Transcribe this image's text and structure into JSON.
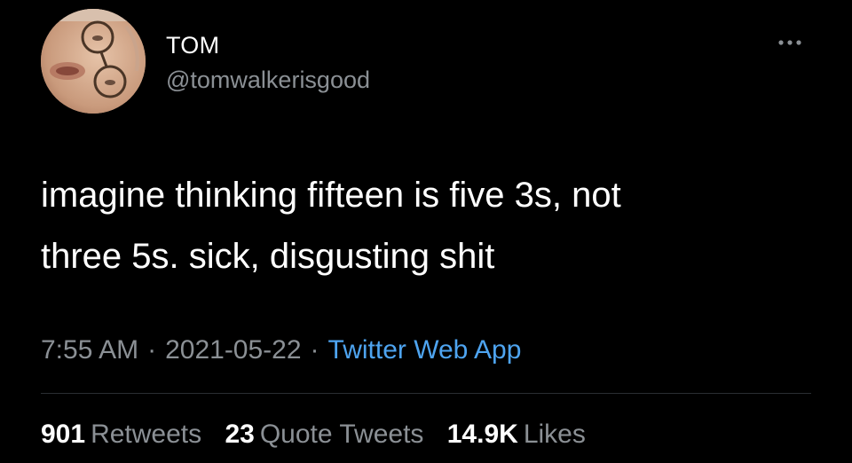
{
  "author": {
    "display_name": "TOM",
    "handle": "@tomwalkerisgood"
  },
  "tweet": {
    "text_lines": [
      "imagine thinking fifteen is five 3s, not",
      "three 5s. sick, disgusting shit"
    ]
  },
  "meta": {
    "time": "7:55 AM",
    "separator": "·",
    "date": "2021-05-22",
    "source": "Twitter Web App"
  },
  "stats": {
    "retweets_count": "901",
    "retweets_label": "Retweets",
    "quote_tweets_count": "23",
    "quote_tweets_label": "Quote Tweets",
    "likes_count": "14.9K",
    "likes_label": "Likes"
  },
  "icons": {
    "more": "more-horizontal-icon"
  },
  "colors": {
    "background": "#000000",
    "primary_text": "#ffffff",
    "secondary_text": "#8b9095",
    "link": "#4ea4f0",
    "divider": "#2a2e32"
  }
}
